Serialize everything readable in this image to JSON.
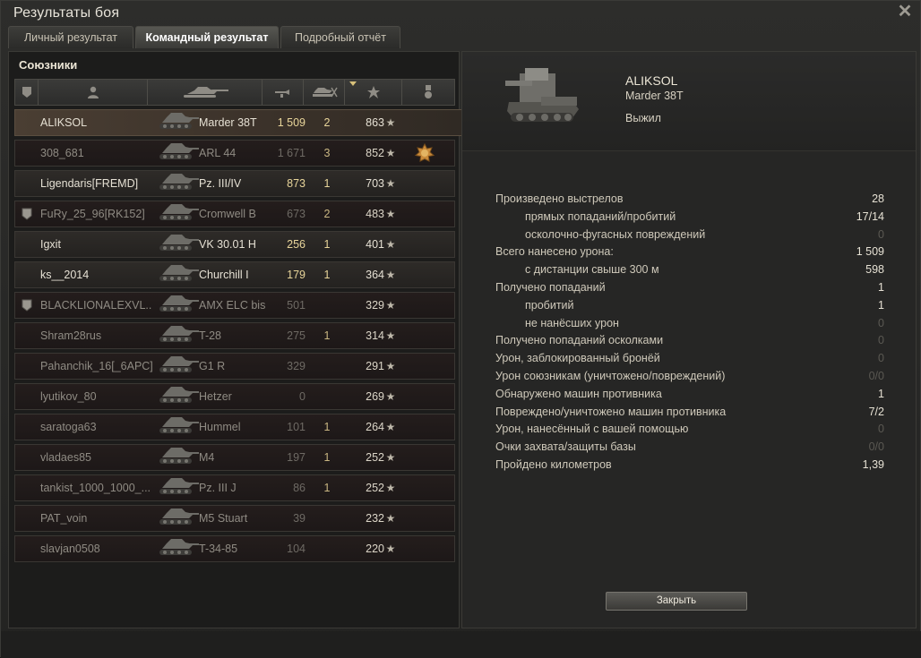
{
  "window": {
    "title": "Результаты боя"
  },
  "tabs": [
    {
      "label": "Личный результат"
    },
    {
      "label": "Командный результат"
    },
    {
      "label": "Подробный отчёт"
    }
  ],
  "team": {
    "label": "Союзники"
  },
  "columns": [
    "clan-icon",
    "player-icon",
    "tank-icon",
    "damage-icon",
    "kills-icon",
    "xp-star-icon",
    "medal-icon"
  ],
  "players": [
    {
      "name": "ALIKSOL",
      "tank": "Marder 38T",
      "damage": "1 509",
      "kills": "2",
      "xp": "863",
      "star": "★",
      "state": "self"
    },
    {
      "name": "308_681",
      "tank": "ARL 44",
      "damage": "1 671",
      "kills": "3",
      "xp": "852",
      "star": "★",
      "state": "dead",
      "medal": true
    },
    {
      "name": "Ligendaris[FREMD]",
      "tank": "Pz. III/IV",
      "damage": "873",
      "kills": "1",
      "xp": "703",
      "star": "★",
      "state": "alive"
    },
    {
      "name": "FuRy_25_96[RK152]",
      "tank": "Cromwell B",
      "damage": "673",
      "kills": "2",
      "xp": "483",
      "star": "★",
      "state": "dead",
      "clan": true
    },
    {
      "name": "Igxit",
      "tank": "VK 30.01 H",
      "damage": "256",
      "kills": "1",
      "xp": "401",
      "star": "★",
      "state": "alive"
    },
    {
      "name": "ks__2014",
      "tank": "Churchill I",
      "damage": "179",
      "kills": "1",
      "xp": "364",
      "star": "★",
      "state": "alive"
    },
    {
      "name": "BLACKLIONALEXVL..",
      "tank": "AMX ELC bis",
      "damage": "501",
      "kills": "",
      "xp": "329",
      "star": "★",
      "state": "dead",
      "clan": true
    },
    {
      "name": "Shram28rus",
      "tank": "T-28",
      "damage": "275",
      "kills": "1",
      "xp": "314",
      "star": "★",
      "state": "dead"
    },
    {
      "name": "Pahanchik_16[_6APC]",
      "tank": "G1 R",
      "damage": "329",
      "kills": "",
      "xp": "291",
      "star": "★",
      "state": "dead"
    },
    {
      "name": "lyutikov_80",
      "tank": "Hetzer",
      "damage": "0",
      "kills": "",
      "xp": "269",
      "star": "★",
      "state": "dead"
    },
    {
      "name": "saratoga63",
      "tank": "Hummel",
      "damage": "101",
      "kills": "1",
      "xp": "264",
      "star": "★",
      "state": "dead"
    },
    {
      "name": "vladaes85",
      "tank": "M4",
      "damage": "197",
      "kills": "1",
      "xp": "252",
      "star": "★",
      "state": "dead"
    },
    {
      "name": "tankist_1000_1000_...",
      "tank": "Pz. III J",
      "damage": "86",
      "kills": "1",
      "xp": "252",
      "star": "★",
      "state": "dead"
    },
    {
      "name": "PAT_voin",
      "tank": "M5 Stuart",
      "damage": "39",
      "kills": "",
      "xp": "232",
      "star": "★",
      "state": "dead"
    },
    {
      "name": "slavjan0508",
      "tank": "T-34-85",
      "damage": "104",
      "kills": "",
      "xp": "220",
      "star": "★",
      "state": "dead"
    }
  ],
  "selected": {
    "name": "ALIKSOL",
    "tank": "Marder 38T",
    "status": "Выжил"
  },
  "stats": [
    {
      "label": "Произведено выстрелов",
      "value": "28",
      "indent": false,
      "dim": false
    },
    {
      "label": "прямых попаданий/пробитий",
      "value": "17/14",
      "indent": true,
      "dim": false
    },
    {
      "label": "осколочно-фугасных повреждений",
      "value": "0",
      "indent": true,
      "dim": true
    },
    {
      "label": "Всего нанесено урона:",
      "value": "1 509",
      "indent": false,
      "dim": false
    },
    {
      "label": "с дистанции свыше 300 м",
      "value": "598",
      "indent": true,
      "dim": false
    },
    {
      "label": "Получено попаданий",
      "value": "1",
      "indent": false,
      "dim": false
    },
    {
      "label": "пробитий",
      "value": "1",
      "indent": true,
      "dim": false
    },
    {
      "label": "не нанёсших урон",
      "value": "0",
      "indent": true,
      "dim": true
    },
    {
      "label": "Получено попаданий осколками",
      "value": "0",
      "indent": false,
      "dim": true
    },
    {
      "label": "Урон, заблокированный бронёй",
      "value": "0",
      "indent": false,
      "dim": true
    },
    {
      "label": "Урон союзникам (уничтожено/повреждений)",
      "value": "0/0",
      "indent": false,
      "dim": true
    },
    {
      "label": "Обнаружено машин противника",
      "value": "1",
      "indent": false,
      "dim": false
    },
    {
      "label": "Повреждено/уничтожено машин противника",
      "value": "7/2",
      "indent": false,
      "dim": false
    },
    {
      "label": "Урон, нанесённый с вашей помощью",
      "value": "0",
      "indent": false,
      "dim": true
    },
    {
      "label": "Очки захвата/защиты базы",
      "value": "0/0",
      "indent": false,
      "dim": true
    },
    {
      "label": "Пройдено километров",
      "value": "1,39",
      "indent": false,
      "dim": false
    }
  ],
  "buttons": {
    "close": "Закрыть"
  }
}
